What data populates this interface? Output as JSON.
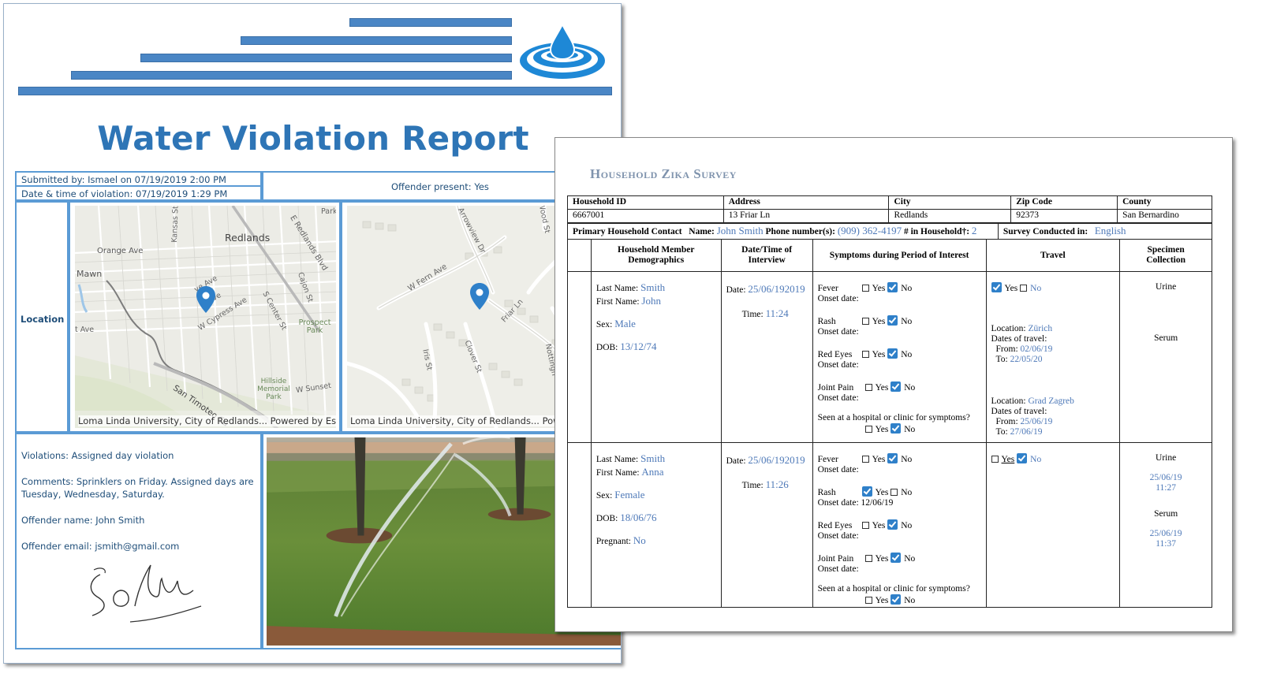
{
  "report": {
    "title": "Water Violation Report",
    "submitted_by": "Submitted by: Ismael on   07/19/2019 2:00 PM",
    "date_of_violation": "Date & time of violation: 07/19/2019 1:29 PM",
    "offender_present": "Offender present: Yes",
    "location_label": "Location",
    "violations": "Violations: Assigned day violation",
    "comments_line1": "Comments: Sprinklers on Friday. Assigned days are",
    "comments_line2": "Tuesday, Wednesday, Saturday.",
    "offender_name": "Offender name: John Smith",
    "offender_email": "Offender email: jsmith@gmail.com",
    "colors": {
      "accent": "#2e75b6",
      "bars": "#4a86c5",
      "box_border": "#5b9bd5"
    },
    "map1": {
      "credit": "Loma Linda University, City of Redlands...   Powered by Esri",
      "labels": [
        "Redlands",
        "Orange Ave",
        "Mawn",
        "Prospect Park",
        "Hillside Memorial Park",
        "Kansas St",
        "E Redlands Blvd",
        "Cajon St",
        "W Cypress Ave",
        "S Center St",
        "W Sunset",
        "San Timoteo Ca",
        "Park",
        "t Ave",
        "ve Ave",
        "n Ave"
      ]
    },
    "map2": {
      "credit": "Loma Linda University, City of Redlands...   Powe",
      "labels": [
        "Arrowview Dr",
        "W Fern Ave",
        "Friar Ln",
        "Iris St",
        "Clover St",
        "Nottingh",
        "Wood St"
      ]
    }
  },
  "survey": {
    "title": "Household Zika Survey",
    "table1": {
      "headers": [
        "Household ID",
        "Address",
        "City",
        "Zip Code",
        "County"
      ],
      "values": [
        "6667001",
        "13 Friar Ln",
        "Redlands",
        "92373",
        "San Bernardino"
      ]
    },
    "contact": {
      "label": "Primary Household Contact",
      "name_label": "Name:",
      "name": "John Smith",
      "phone_label": "Phone number(s):",
      "phone": "(909) 362-4197",
      "household_label": "# in Household†:",
      "household_count": "2",
      "conducted_label": "Survey Conducted in:",
      "conducted_in": "English"
    },
    "columns": [
      "Household Member Demographics",
      "Date/Time of Interview",
      "Symptoms during Period of Interest",
      "Travel",
      "Specimen Collection"
    ],
    "column_lines": {
      "demo": [
        "Household Member",
        "Demographics"
      ],
      "date": [
        "Date/Time of",
        "Interview"
      ],
      "specimen": [
        "Specimen",
        "Collection"
      ]
    },
    "labels": {
      "last_name": "Last Name:",
      "first_name": "First Name:",
      "sex": "Sex:",
      "dob": "DOB:",
      "pregnant": "Pregnant:",
      "date": "Date:",
      "time": "Time:",
      "onset": "Onset date:",
      "yes": "Yes",
      "no": "No",
      "seen": "Seen at a hospital or clinic for symptoms?",
      "location": "Location:",
      "dates_travel": "Dates of travel:",
      "from": "From:",
      "to": "To:"
    },
    "symptoms": [
      "Fever",
      "Rash",
      "Red Eyes",
      "Joint Pain"
    ],
    "members": [
      {
        "last_name": "Smith",
        "first_name": "John",
        "sex": "Male",
        "dob": "13/12/74",
        "date": "25/06/192019",
        "time": "11:24",
        "rash_onset": "",
        "travel": [
          {
            "location": "Zürich",
            "from": "02/06/19",
            "to": "22/05/20"
          },
          {
            "location": "Grad Zagreb",
            "from": "25/06/19",
            "to": "27/06/19"
          }
        ],
        "specimens": [
          "Urine",
          "Serum"
        ]
      },
      {
        "last_name": "Smith",
        "first_name": "Anna",
        "sex": "Female",
        "dob": "18/06/76",
        "pregnant": "No",
        "date": "25/06/192019",
        "time": "11:26",
        "rash_onset": "Onset date: 12/06/19",
        "specimens": [
          {
            "type": "Urine",
            "date": "25/06/19",
            "time": "11:27"
          },
          {
            "type": "Serum",
            "date": "25/06/19",
            "time": "11:37"
          }
        ]
      }
    ]
  }
}
